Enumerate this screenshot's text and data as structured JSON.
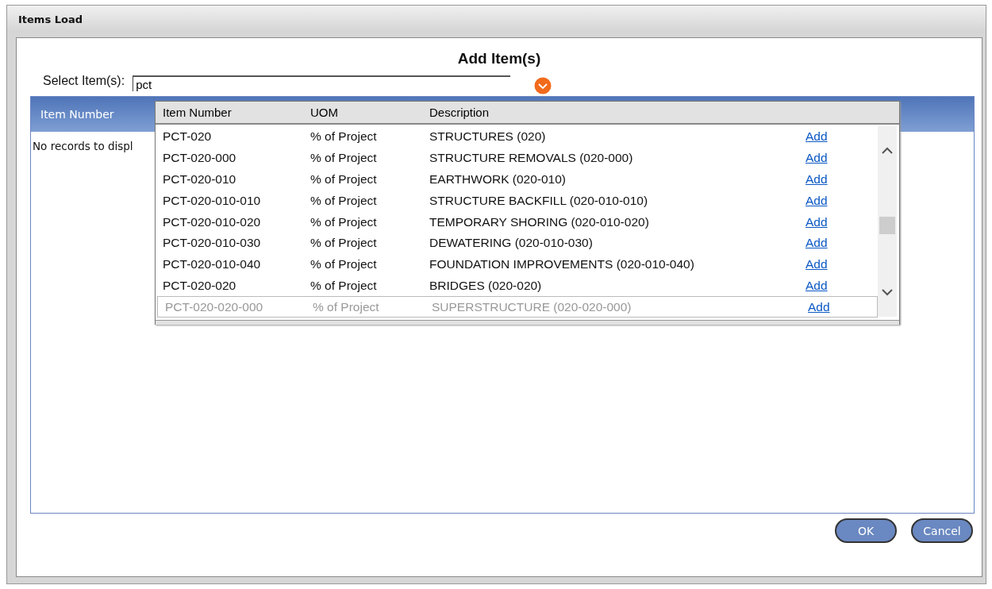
{
  "window": {
    "title": "Items Load"
  },
  "dialog": {
    "heading": "Add Item(s)"
  },
  "select": {
    "label": "Select Item(s):",
    "value": "pct"
  },
  "grid": {
    "columns": [
      "Item Number"
    ],
    "empty_text": "No records to displ"
  },
  "dropdown": {
    "columns": [
      "Item Number",
      "UOM",
      "Description"
    ],
    "rows": [
      {
        "item_number": "PCT-020",
        "uom": "% of Project",
        "description": "STRUCTURES (020)",
        "action": "Add",
        "disabled": false
      },
      {
        "item_number": "PCT-020-000",
        "uom": "% of Project",
        "description": "STRUCTURE REMOVALS (020-000)",
        "action": "Add",
        "disabled": false
      },
      {
        "item_number": "PCT-020-010",
        "uom": "% of Project",
        "description": "EARTHWORK (020-010)",
        "action": "Add",
        "disabled": false
      },
      {
        "item_number": "PCT-020-010-010",
        "uom": "% of Project",
        "description": "STRUCTURE BACKFILL (020-010-010)",
        "action": "Add",
        "disabled": false
      },
      {
        "item_number": "PCT-020-010-020",
        "uom": "% of Project",
        "description": "TEMPORARY SHORING (020-010-020)",
        "action": "Add",
        "disabled": false
      },
      {
        "item_number": "PCT-020-010-030",
        "uom": "% of Project",
        "description": "DEWATERING (020-010-030)",
        "action": "Add",
        "disabled": false
      },
      {
        "item_number": "PCT-020-010-040",
        "uom": "% of Project",
        "description": "FOUNDATION IMPROVEMENTS (020-010-040)",
        "action": "Add",
        "disabled": false
      },
      {
        "item_number": "PCT-020-020",
        "uom": "% of Project",
        "description": "BRIDGES (020-020)",
        "action": "Add",
        "disabled": false
      },
      {
        "item_number": "PCT-020-020-000",
        "uom": "% of Project",
        "description": "SUPERSTRUCTURE (020-020-000)",
        "action": "Add",
        "disabled": true
      }
    ]
  },
  "buttons": [
    "OK",
    "Cancel"
  ]
}
